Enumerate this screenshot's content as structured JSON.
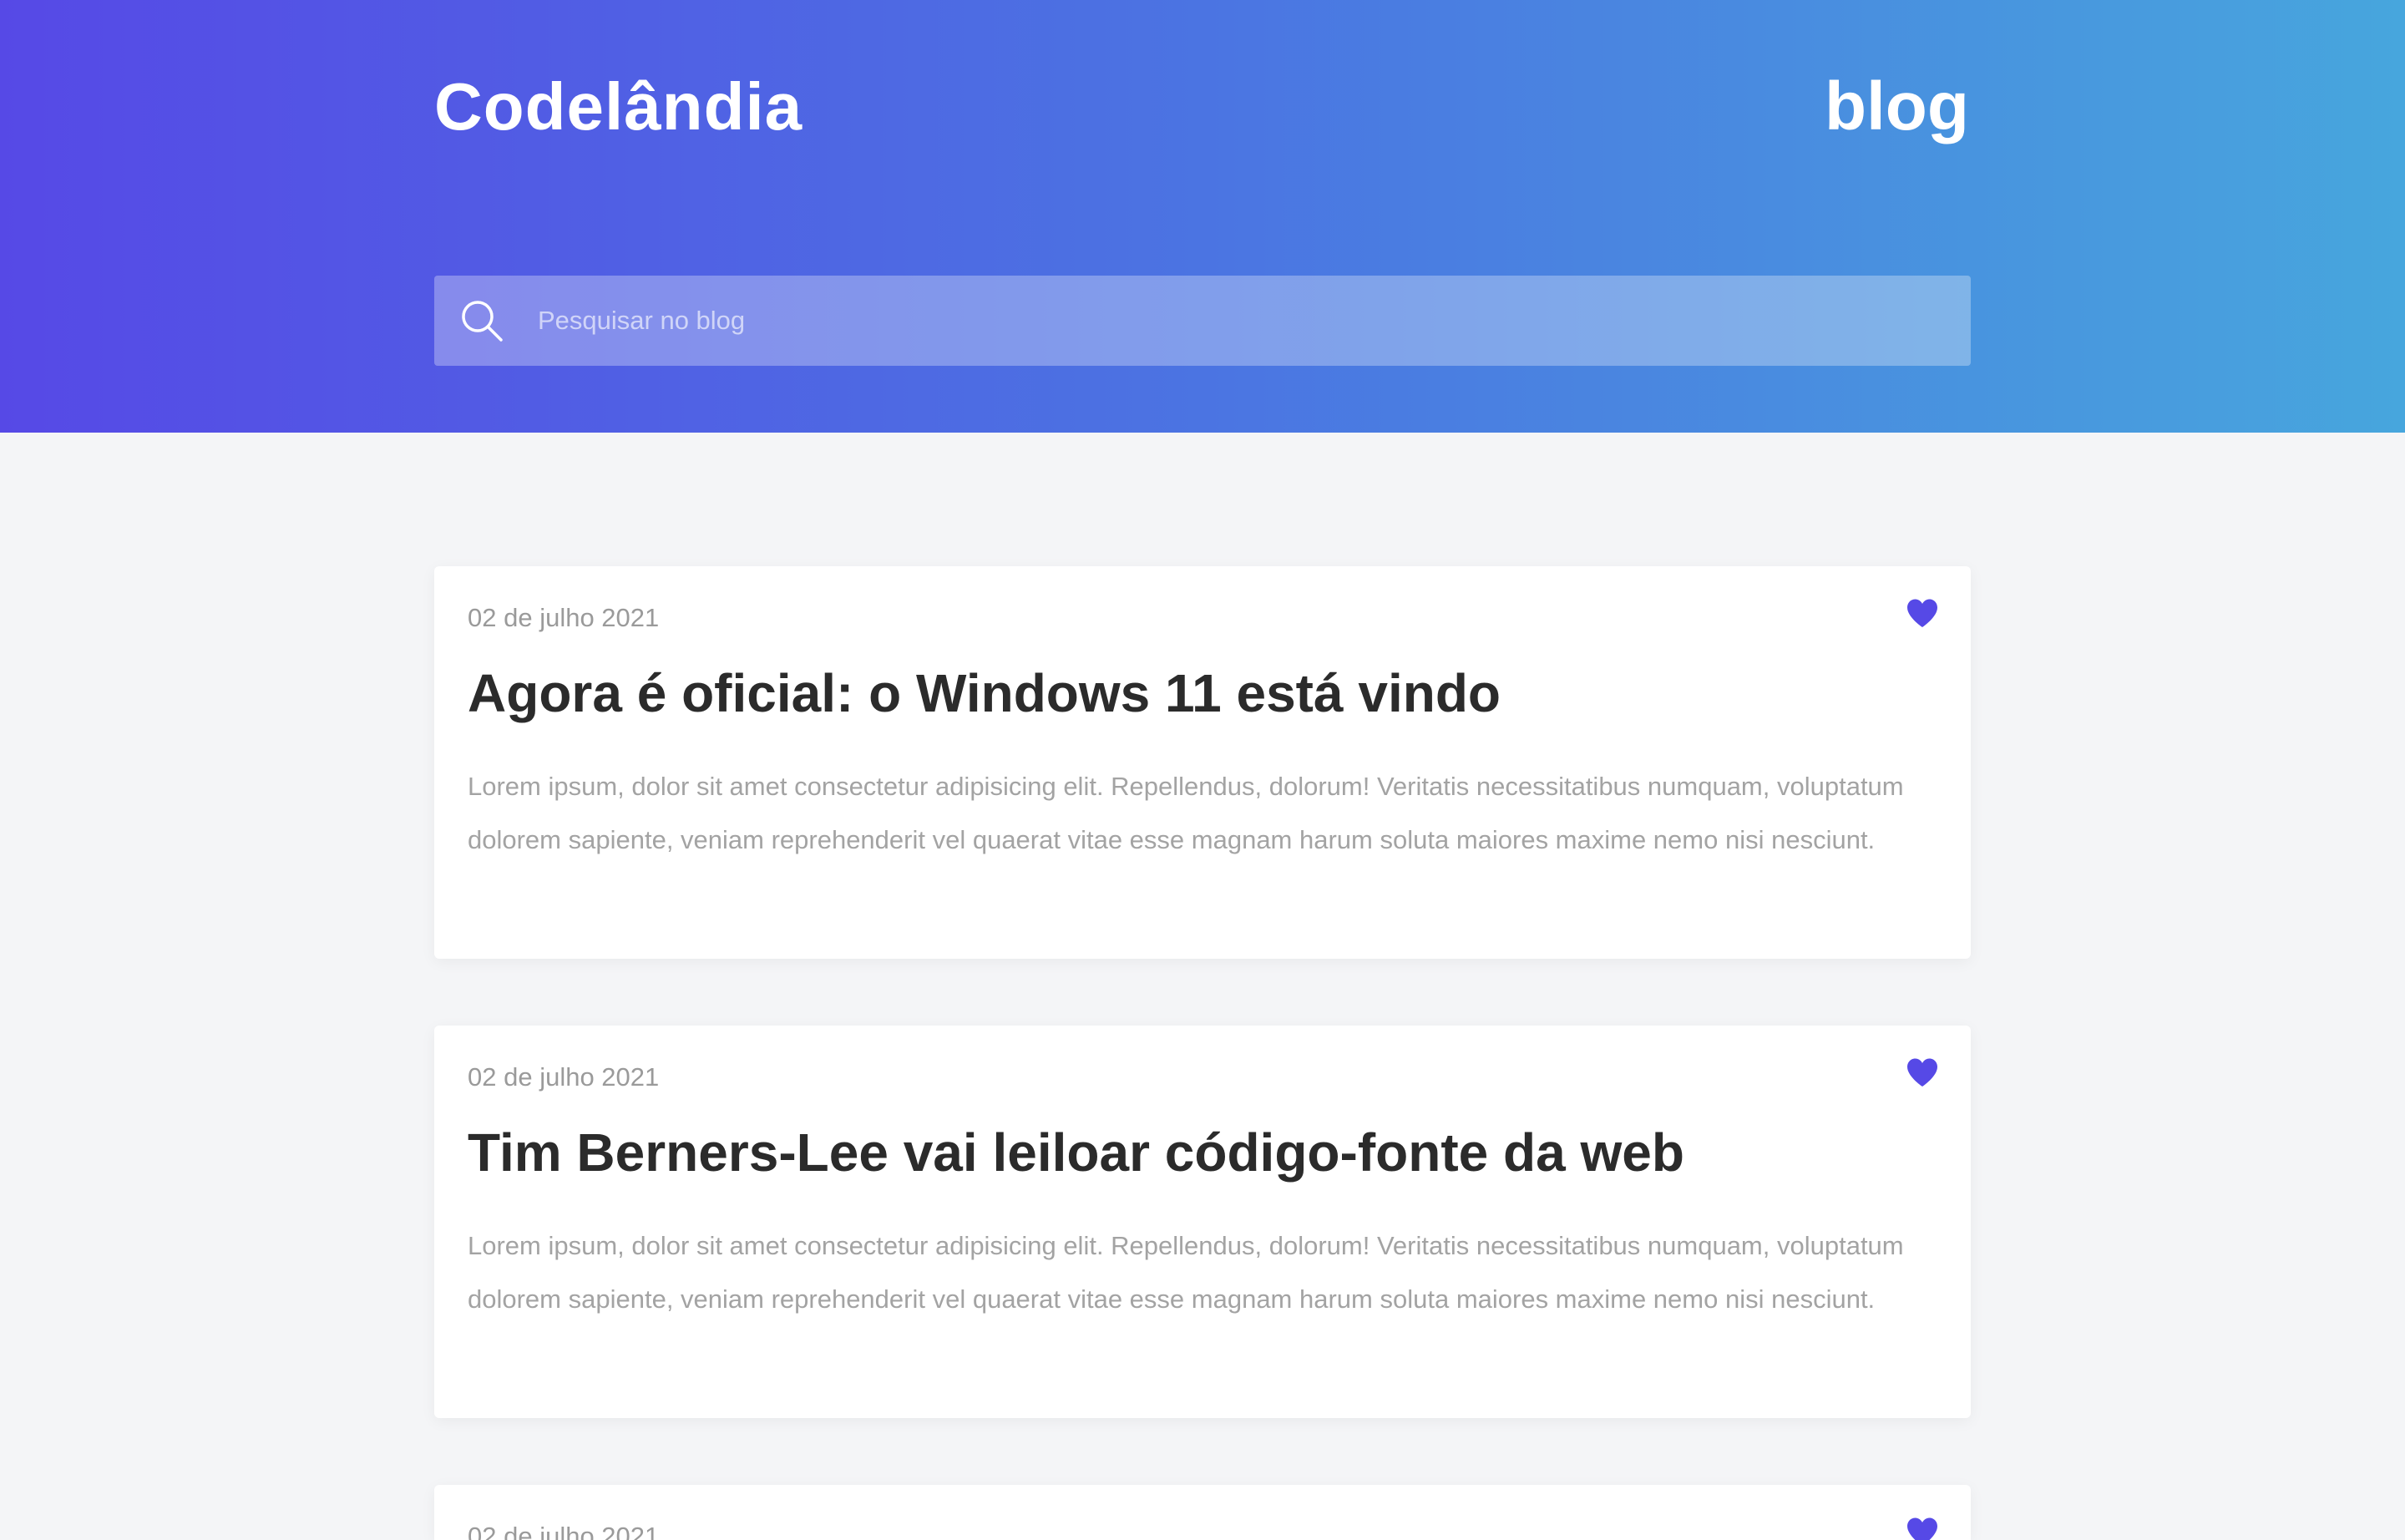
{
  "header": {
    "brand": "Codelândia",
    "section": "blog",
    "search": {
      "placeholder": "Pesquisar no blog"
    }
  },
  "colors": {
    "accent": "#5649e6",
    "gradient_start": "#5649e6",
    "gradient_end": "#47a6dd",
    "title_text": "#2b2b2b",
    "muted_text": "#a3a3a3"
  },
  "icons": {
    "search": "search-icon",
    "like": "heart-icon"
  },
  "posts": [
    {
      "date": "02 de julho 2021",
      "title": "Agora é oficial: o Windows 11 está vindo",
      "excerpt": "Lorem ipsum, dolor sit amet consectetur adipisicing elit. Repellendus, dolorum! Veritatis necessitatibus numquam, voluptatum dolorem sapiente, veniam reprehenderit vel quaerat vitae esse magnam harum soluta maiores maxime nemo nisi nesciunt."
    },
    {
      "date": "02 de julho 2021",
      "title": "Tim Berners-Lee vai leiloar código-fonte da web",
      "excerpt": "Lorem ipsum, dolor sit amet consectetur adipisicing elit. Repellendus, dolorum! Veritatis necessitatibus numquam, voluptatum dolorem sapiente, veniam reprehenderit vel quaerat vitae esse magnam harum soluta maiores maxime nemo nisi nesciunt."
    },
    {
      "date": "02 de julho 2021",
      "title": "",
      "excerpt": ""
    }
  ]
}
